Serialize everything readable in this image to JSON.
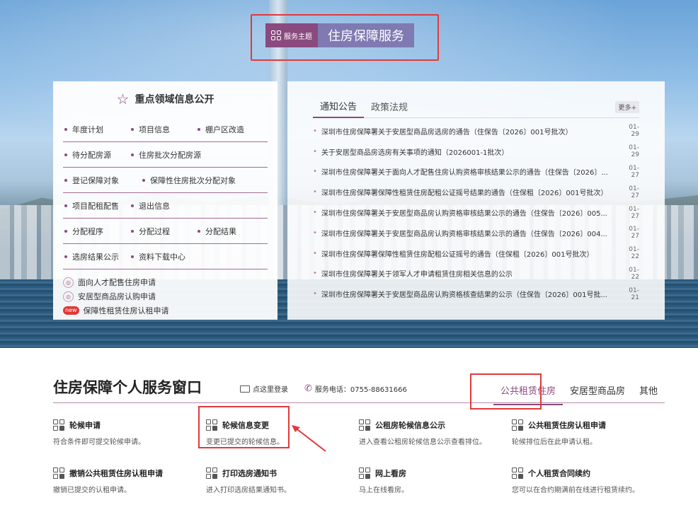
{
  "theme": {
    "tag": "服务主题",
    "title": "住房保障服务"
  },
  "key_info": {
    "title": "重点领域信息公开",
    "rows": [
      [
        "年度计划",
        "项目信息",
        "棚户区改造"
      ],
      [
        "待分配房源",
        "住房批次分配房源"
      ],
      [
        "登记保障对象",
        "保障性住房批次分配对象"
      ],
      [
        "项目配租配售",
        "退出信息"
      ],
      [
        "分配程序",
        "分配过程",
        "分配结果"
      ],
      [
        "选房结果公示",
        "资料下载中心"
      ]
    ],
    "links": [
      {
        "icon": "apply-icon",
        "label": "面向人才配售住房申请"
      },
      {
        "icon": "apply-icon",
        "label": "安居型商品房认购申请"
      },
      {
        "icon": "new-badge-icon",
        "badge": "new",
        "label": "保障性租赁住房认租申请"
      }
    ]
  },
  "news": {
    "tabs": [
      "通知公告",
      "政策法规"
    ],
    "more": "更多+",
    "items": [
      {
        "title": "深圳市住房保障署关于安居型商品房选房的通告（住保告〔2026〕001号批次）",
        "date": "01-29"
      },
      {
        "title": "关于安居型商品房选房有关事项的通知（2026001-1批次）",
        "date": "01-29"
      },
      {
        "title": "深圳市住房保障署关于面向人才配售住房认购资格审核结果公示的通告（住保告〔2026〕...",
        "date": "01-27"
      },
      {
        "title": "深圳市住房保障署保障性租赁住房配租公证摇号结果的通告（住保租〔2026〕001号批次）",
        "date": "01-27"
      },
      {
        "title": "深圳市住房保障署关于安居型商品房认购资格审核结果公示的通告（住保告〔2026〕005...",
        "date": "01-27"
      },
      {
        "title": "深圳市住房保障署关于安居型商品房认购资格审核结果公示的通告（住保告〔2026〕004...",
        "date": "01-27"
      },
      {
        "title": "深圳市住房保障署保障性租赁住房配租公证摇号的通告（住保租〔2026〕001号批次）",
        "date": "01-22"
      },
      {
        "title": "深圳市住房保障署关于领军人才申请租赁住房相关信息的公示",
        "date": "01-22"
      },
      {
        "title": "深圳市住房保障署关于安居型商品房认购资格核查结果的公示（住保告〔2026〕001号批...",
        "date": "01-21"
      }
    ]
  },
  "service": {
    "title": "住房保障个人服务窗口",
    "login": "点这里登录",
    "phone": "服务电话：0755-88631666",
    "tabs": [
      "公共租赁住房",
      "安居型商品房",
      "其他"
    ],
    "cards": [
      {
        "title": "轮候申请",
        "desc": "符合条件即可提交轮候申请。"
      },
      {
        "title": "轮候信息变更",
        "desc": "变更已提交的轮候信息。"
      },
      {
        "title": "公租房轮候信息公示",
        "desc": "进入查看公租房轮候信息公示查看排位。"
      },
      {
        "title": "公共租赁住房认租申请",
        "desc": "轮候排位后在此申请认租。"
      },
      {
        "title": "撤销公共租赁住房认租申请",
        "desc": "撤销已提交的认租申请。"
      },
      {
        "title": "打印选房通知书",
        "desc": "进入打印选房结果通知书。"
      },
      {
        "title": "网上看房",
        "desc": "马上在线看房。"
      },
      {
        "title": "个人租赁合同续约",
        "desc": "您可以在合约期满前在线进行租赁续约。"
      }
    ]
  },
  "colors": {
    "accent": "#8a4a7f",
    "highlight": "#e03a3a"
  }
}
